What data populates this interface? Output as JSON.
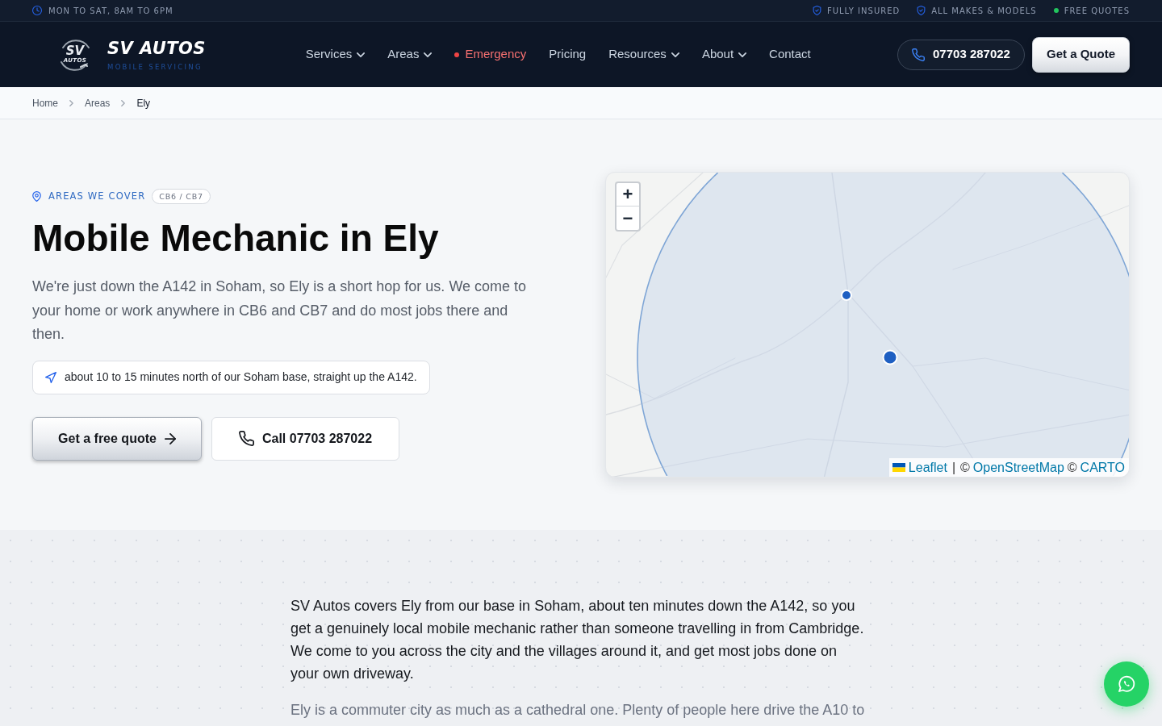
{
  "top_bar": {
    "hours": "MON TO SAT, 8AM TO 6PM",
    "badges": [
      {
        "kind": "shield",
        "label": "FULLY INSURED"
      },
      {
        "kind": "shield",
        "label": "ALL MAKES & MODELS"
      },
      {
        "kind": "dot",
        "label": "FREE QUOTES"
      }
    ]
  },
  "header": {
    "logo": {
      "emblem_top": "SV",
      "emblem_bottom": "AUTOS",
      "name": "SV AUTOS",
      "tagline": "MOBILE SERVICING"
    },
    "nav": [
      {
        "kind": "dropdown",
        "label": "Services"
      },
      {
        "kind": "dropdown",
        "label": "Areas"
      },
      {
        "kind": "alert",
        "label": "Emergency"
      },
      {
        "kind": "plain",
        "label": "Pricing"
      },
      {
        "kind": "dropdown",
        "label": "Resources"
      },
      {
        "kind": "dropdown",
        "label": "About"
      },
      {
        "kind": "plain",
        "label": "Contact"
      }
    ],
    "phone": "07703 287022",
    "quote_button": "Get a Quote"
  },
  "breadcrumb": [
    {
      "label": "Home",
      "current": false
    },
    {
      "label": "Areas",
      "current": false
    },
    {
      "label": "Ely",
      "current": true
    }
  ],
  "hero": {
    "eyebrow": "AREAS WE COVER",
    "postcode_badge": "CB6 / CB7",
    "title": "Mobile Mechanic in Ely",
    "intro": "We're just down the A142 in Soham, so Ely is a short hop for us. We come to your home or work anywhere in CB6 and CB7 and do most jobs there and then.",
    "travel_note": "about 10 to 15 minutes north of our Soham base, straight up the A142.",
    "buttons": [
      {
        "kind": "primary",
        "label": "Get a free quote"
      },
      {
        "kind": "call",
        "label": "Call 07703 287022"
      }
    ]
  },
  "map": {
    "zoom_in": "+",
    "zoom_out": "−",
    "attribution": [
      {
        "kind": "flag_link",
        "label": "Leaflet"
      },
      {
        "kind": "separator",
        "label": "|"
      },
      {
        "kind": "text",
        "label": "©"
      },
      {
        "kind": "link",
        "label": "OpenStreetMap"
      },
      {
        "kind": "text",
        "label": "©"
      },
      {
        "kind": "link",
        "label": "CARTO"
      }
    ]
  },
  "content": {
    "paragraphs": [
      {
        "kind": "lead",
        "text": "SV Autos covers Ely from our base in Soham, about ten minutes down the A142, so you get a genuinely local mobile mechanic rather than someone travelling in from Cambridge. We come to you across the city and the villages around it, and get most jobs done on your own driveway."
      },
      {
        "kind": "body",
        "text": "Ely is a commuter city as much as a cathedral one. Plenty of people here drive the A10 to"
      }
    ]
  }
}
